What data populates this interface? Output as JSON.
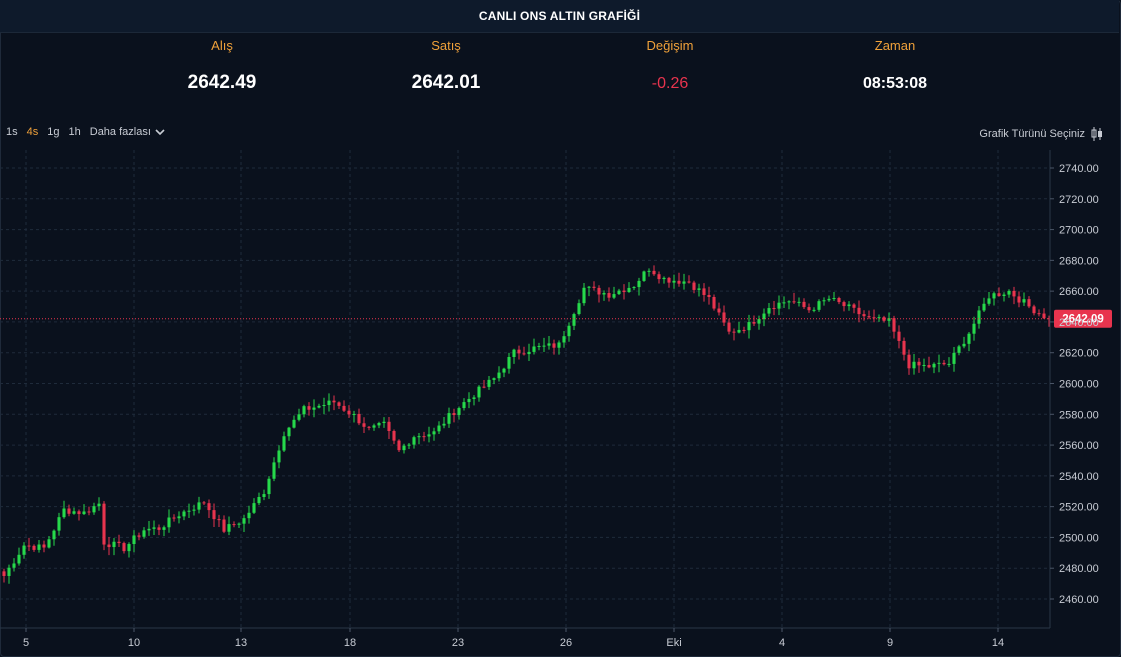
{
  "header": {
    "title": "CANLI ONS ALTIN GRAFİĞİ"
  },
  "quotes": {
    "bid_label": "Alış",
    "bid_value": "2642.49",
    "ask_label": "Satış",
    "ask_value": "2642.01",
    "change_label": "Değişim",
    "change_value": "-0.26",
    "time_label": "Zaman",
    "time_value": "08:53:08"
  },
  "toolbar": {
    "timeframes": [
      "1s",
      "4s",
      "1g",
      "1h"
    ],
    "active_timeframe": "4s",
    "more_label": "Daha fazlası",
    "chart_type_label": "Grafik Türünü Seçiniz",
    "chart_type_icon": "candlestick-icon",
    "more_icon": "chevron-down-icon"
  },
  "colors": {
    "up": "#26d94b",
    "down": "#e8344e",
    "accent": "#f0a13a",
    "price_line": "#e8344e"
  },
  "chart_data": {
    "type": "candlestick",
    "title": "",
    "ylim": [
      2440,
      2750
    ],
    "y_ticks": [
      "2740.00",
      "2720.00",
      "2700.00",
      "2680.00",
      "2660.00",
      "2640.00",
      "2620.00",
      "2600.00",
      "2580.00",
      "2560.00",
      "2540.00",
      "2520.00",
      "2500.00",
      "2480.00",
      "2460.00"
    ],
    "x_ticks": [
      "5",
      "10",
      "13",
      "18",
      "23",
      "26",
      "Eki",
      "4",
      "9",
      "14"
    ],
    "last_price_label": "2642.09",
    "last_price": 2642.09,
    "grid": true,
    "candle_count": 210,
    "keypoints": [
      [
        0,
        2475
      ],
      [
        4,
        2495
      ],
      [
        8,
        2493
      ],
      [
        12,
        2518
      ],
      [
        16,
        2516
      ],
      [
        19,
        2522
      ],
      [
        20,
        2497
      ],
      [
        24,
        2493
      ],
      [
        28,
        2505
      ],
      [
        31,
        2506
      ],
      [
        35,
        2515
      ],
      [
        40,
        2523
      ],
      [
        44,
        2505
      ],
      [
        48,
        2512
      ],
      [
        52,
        2530
      ],
      [
        56,
        2568
      ],
      [
        60,
        2583
      ],
      [
        66,
        2588
      ],
      [
        70,
        2579
      ],
      [
        73,
        2570
      ],
      [
        76,
        2573
      ],
      [
        79,
        2556
      ],
      [
        82,
        2566
      ],
      [
        86,
        2568
      ],
      [
        90,
        2582
      ],
      [
        94,
        2593
      ],
      [
        98,
        2603
      ],
      [
        102,
        2620
      ],
      [
        106,
        2623
      ],
      [
        111,
        2625
      ],
      [
        116,
        2662
      ],
      [
        121,
        2658
      ],
      [
        126,
        2664
      ],
      [
        129,
        2675
      ],
      [
        132,
        2668
      ],
      [
        137,
        2666
      ],
      [
        141,
        2655
      ],
      [
        145,
        2633
      ],
      [
        149,
        2638
      ],
      [
        153,
        2650
      ],
      [
        157,
        2654
      ],
      [
        161,
        2648
      ],
      [
        165,
        2655
      ],
      [
        169,
        2649
      ],
      [
        173,
        2642
      ],
      [
        177,
        2640
      ],
      [
        181,
        2612
      ],
      [
        185,
        2611
      ],
      [
        189,
        2613
      ],
      [
        193,
        2633
      ],
      [
        197,
        2657
      ],
      [
        201,
        2660
      ],
      [
        205,
        2650
      ],
      [
        209,
        2642
      ]
    ]
  }
}
